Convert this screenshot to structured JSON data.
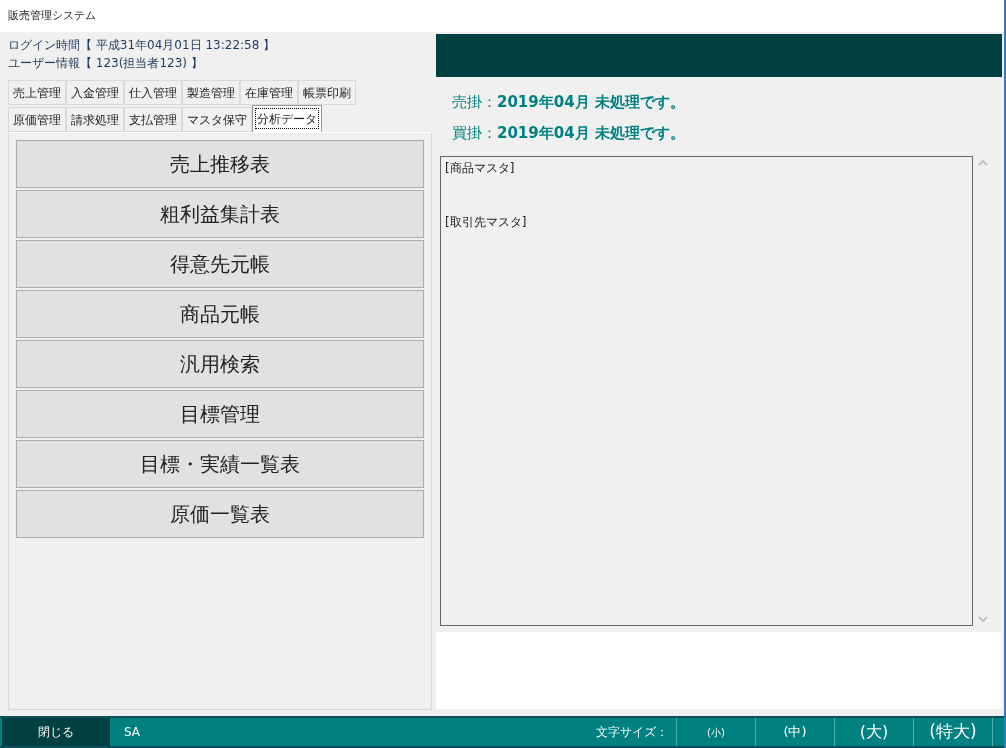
{
  "window": {
    "title": "販売管理システム"
  },
  "login": {
    "time": "ログイン時間【 平成31年04月01日 13:22:58 】",
    "user": "ユーザー情報【 123(担当者123) 】"
  },
  "tab_rows": [
    [
      {
        "label": "売上管理",
        "selected": false
      },
      {
        "label": "入金管理",
        "selected": false
      },
      {
        "label": "仕入管理",
        "selected": false
      },
      {
        "label": "製造管理",
        "selected": false
      },
      {
        "label": "在庫管理",
        "selected": false
      },
      {
        "label": "帳票印刷",
        "selected": false
      }
    ],
    [
      {
        "label": "原価管理",
        "selected": false
      },
      {
        "label": "請求処理",
        "selected": false
      },
      {
        "label": "支払管理",
        "selected": false
      },
      {
        "label": "マスタ保守",
        "selected": false
      },
      {
        "label": "分析データ",
        "selected": true
      }
    ]
  ],
  "menu_buttons": [
    "売上推移表",
    "粗利益集計表",
    "得意先元帳",
    "商品元帳",
    "汎用検索",
    "目標管理",
    "目標・実績一覧表",
    "原価一覧表"
  ],
  "notices": [
    "売掛：**2019年04月  未処理です。**",
    "買掛：**2019年04月  未処理です。**"
  ],
  "log_lines": [
    "[商品マスタ]",
    "[取引先マスタ]"
  ],
  "status_bar": {
    "close_button": "閉じる",
    "user_code": "SA",
    "font_size_label": "文字サイズ：",
    "font_size_buttons": [
      {
        "label": "(小)",
        "kind": "small"
      },
      {
        "label": "(中)",
        "kind": "medium"
      },
      {
        "label": "(大)",
        "kind": "large"
      },
      {
        "label": "(特大)",
        "kind": "xlarge"
      }
    ]
  }
}
